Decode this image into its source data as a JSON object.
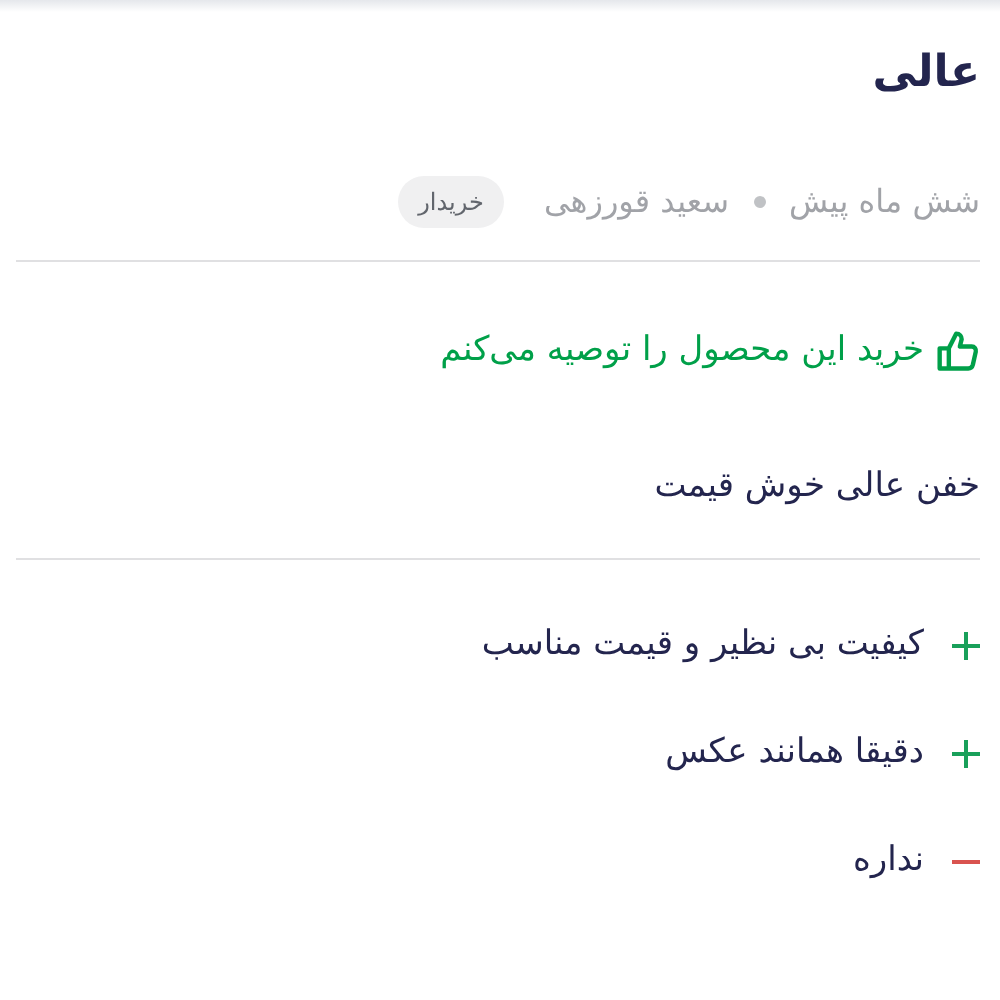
{
  "review": {
    "title": "عالی",
    "time": "شش ماه پیش",
    "author": "سعید قورزهی",
    "badge": "خریدار",
    "recommendation": {
      "kind": "recommend",
      "text": "خرید این محصول را توصیه می‌کنم"
    },
    "body": "خفن عالی خوش قیمت",
    "points": [
      {
        "kind": "pro",
        "text": "کیفیت بی نظیر و قیمت مناسب"
      },
      {
        "kind": "pro",
        "text": "دقیقا همانند عکس"
      },
      {
        "kind": "con",
        "text": "نداره"
      }
    ]
  }
}
